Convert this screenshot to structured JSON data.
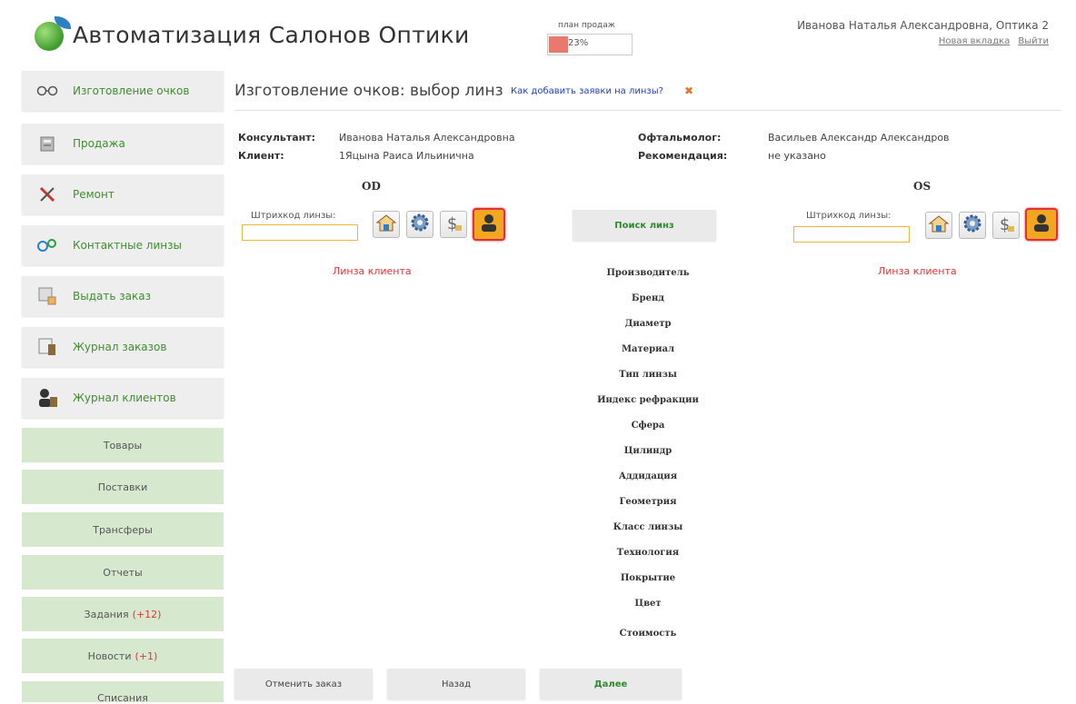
{
  "header": {
    "app_title": "Автоматизация Салонов Оптики",
    "plan_label": "план продаж",
    "plan_value": "23%",
    "plan_progress": 0.23,
    "user": "Иванова Наталья Александровна, Оптика 2",
    "new_tab": "Новая вкладка",
    "logout": "Выйти"
  },
  "sidebar": {
    "items": [
      {
        "label": "Изготовление очков",
        "icon": "glasses-icon"
      },
      {
        "label": "Продажа",
        "icon": "cash-register-icon"
      },
      {
        "label": "Ремонт",
        "icon": "tools-icon"
      },
      {
        "label": "Контактные линзы",
        "icon": "contact-lens-icon"
      },
      {
        "label": "Выдать заказ",
        "icon": "hand-over-icon"
      },
      {
        "label": "Журнал заказов",
        "icon": "orders-log-icon"
      },
      {
        "label": "Журнал клиентов",
        "icon": "clients-log-icon"
      }
    ],
    "sub_items": [
      {
        "label": "Товары",
        "badge": ""
      },
      {
        "label": "Поставки",
        "badge": ""
      },
      {
        "label": "Трансферы",
        "badge": ""
      },
      {
        "label": "Отчеты",
        "badge": ""
      },
      {
        "label": "Задания",
        "badge": "(+12)"
      },
      {
        "label": "Новости",
        "badge": "(+1)"
      },
      {
        "label": "Списания",
        "badge": ""
      }
    ]
  },
  "main": {
    "title": "Изготовление очков: выбор линз",
    "help_link": "Как добавить заявки на линзы?",
    "help_mark": "✖",
    "consultant_label": "Консультант:",
    "consultant_value": "Иванова Наталья Александровна",
    "client_label": "Клиент:",
    "client_value": "1Яцына Раиса Ильинична",
    "ophthalmologist_label": "Офтальмолог:",
    "ophthalmologist_value": "Васильев Александр Александров",
    "recommendation_label": "Рекомендация:",
    "recommendation_value": "не указано",
    "od_label": "OD",
    "os_label": "OS",
    "barcode_label": "Штрихкод линзы:",
    "client_lens": "Линза клиента",
    "search_button": "Поиск линз",
    "params": [
      "Производитель",
      "Бренд",
      "Диаметр",
      "Материал",
      "Тип линзы",
      "Индекс рефракции",
      "Сфера",
      "Цилиндр",
      "Аддидация",
      "Геометрия",
      "Класс линзы",
      "Технология",
      "Покрытие",
      "Цвет",
      "Стоимость"
    ],
    "cancel_button": "Отменить заказ",
    "back_button": "Назад",
    "next_button": "Далее"
  },
  "colors": {
    "accent_green": "#3f8e2e",
    "alert_red": "#e53333",
    "link_blue": "#2040c0"
  }
}
